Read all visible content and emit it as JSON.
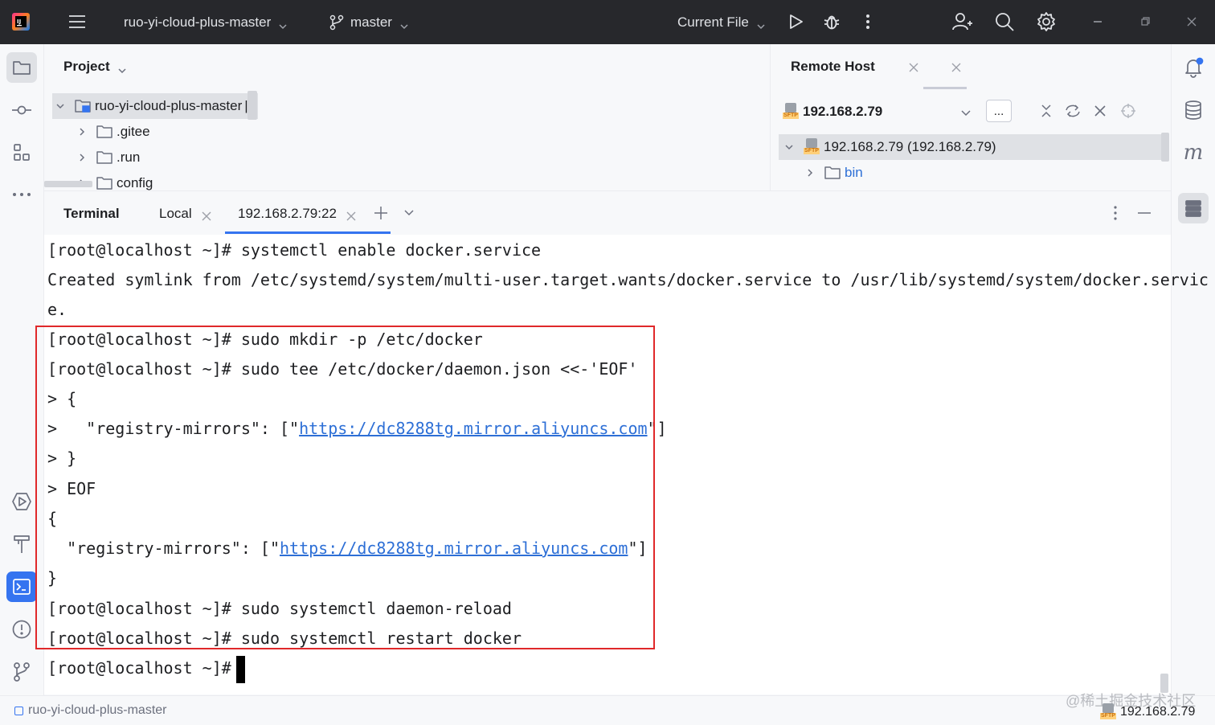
{
  "titlebar": {
    "project_name": "ruo-yi-cloud-plus-master",
    "branch": "master",
    "run_config": "Current File"
  },
  "project_panel": {
    "title": "Project",
    "tree": [
      {
        "label": "ruo-yi-cloud-plus-master",
        "expanded": true,
        "level": 0
      },
      {
        "label": ".gitee",
        "expanded": false,
        "level": 1
      },
      {
        "label": ".run",
        "expanded": false,
        "level": 1
      },
      {
        "label": "config",
        "expanded": false,
        "level": 1
      }
    ]
  },
  "remote_panel": {
    "title": "Remote Host",
    "host": "192.168.2.79",
    "more_label": "...",
    "tree": [
      {
        "label": "192.168.2.79 (192.168.2.79)",
        "expanded": true
      },
      {
        "label": "bin",
        "expanded": false
      }
    ]
  },
  "terminal": {
    "title": "Terminal",
    "tabs": [
      {
        "label": "Local",
        "active": false
      },
      {
        "label": "192.168.2.79:22",
        "active": true
      }
    ],
    "lines": [
      {
        "text": "[root@localhost ~]# systemctl enable docker.service"
      },
      {
        "text": "Created symlink from /etc/systemd/system/multi-user.target.wants/docker.service to /usr/lib/systemd/system/docker.servic"
      },
      {
        "text": "e."
      },
      {
        "text": "[root@localhost ~]# sudo mkdir -p /etc/docker"
      },
      {
        "text": "[root@localhost ~]# sudo tee /etc/docker/daemon.json <<-'EOF'"
      },
      {
        "text": "> {"
      },
      {
        "pre": ">   \"registry-mirrors\": [\"",
        "link": "https://dc8288tg.mirror.aliyuncs.com",
        "post": "\"]"
      },
      {
        "text": "> }"
      },
      {
        "text": "> EOF"
      },
      {
        "text": "{"
      },
      {
        "pre": "  \"registry-mirrors\": [\"",
        "link": "https://dc8288tg.mirror.aliyuncs.com",
        "post": "\"]"
      },
      {
        "text": "}"
      },
      {
        "text": "[root@localhost ~]# sudo systemctl daemon-reload"
      },
      {
        "text": "[root@localhost ~]# sudo systemctl restart docker"
      },
      {
        "text": "[root@localhost ~]#"
      }
    ]
  },
  "statusbar": {
    "project": "ruo-yi-cloud-plus-master",
    "watermark": "@稀土掘金技术社区",
    "host": "192.168.2.79"
  },
  "colors": {
    "accent": "#3574f0",
    "highlight_border": "#e0282a",
    "titlebar_bg": "#27282c",
    "link": "#2d6fd6"
  }
}
